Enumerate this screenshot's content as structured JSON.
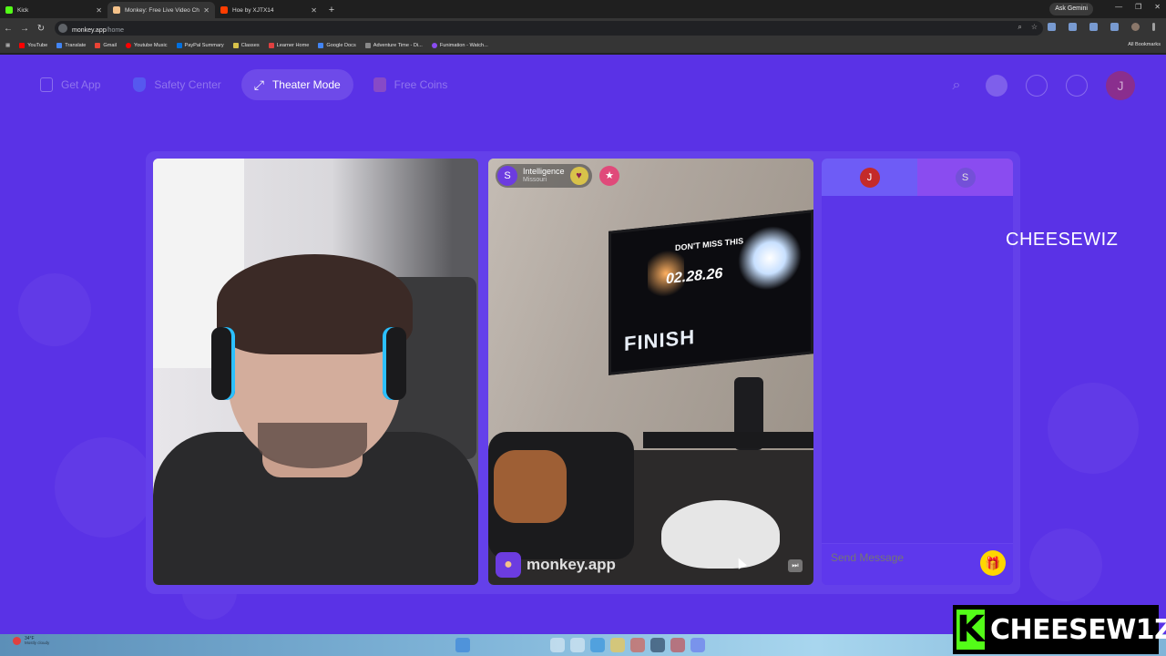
{
  "browser": {
    "tabs": [
      {
        "title": "Kick",
        "active": false,
        "favicon_color": "#53fc18"
      },
      {
        "title": "Monkey: Free Live Video Ch",
        "active": true,
        "favicon_color": "#f5c28a"
      },
      {
        "title": "Hoe by XJTX14",
        "active": false,
        "favicon_color": "#ff3d00"
      }
    ],
    "new_tab": "+",
    "gemini_label": "Ask Gemini",
    "url_host": "monkey.app",
    "url_path": "/home",
    "bookmarks": [
      {
        "label": "YouTube",
        "color": "#ff0000"
      },
      {
        "label": "Translate",
        "color": "#4285f4"
      },
      {
        "label": "Gmail",
        "color": "#ea4335"
      },
      {
        "label": "Youtube Music",
        "color": "#ff0000"
      },
      {
        "label": "PayPal Summary",
        "color": "#0070e0"
      },
      {
        "label": "Classes",
        "color": "#d8c24a"
      },
      {
        "label": "Learner Home",
        "color": "#e04040"
      },
      {
        "label": "Google Docs",
        "color": "#4285f4"
      },
      {
        "label": "Adventure Time - Di...",
        "color": "#888888"
      },
      {
        "label": "Funimation - Watch...",
        "color": "#8a4cf0"
      }
    ],
    "all_bookmarks": "All Bookmarks"
  },
  "app": {
    "nav": {
      "get_app": "Get App",
      "safety_center": "Safety Center",
      "theater_mode": "Theater Mode",
      "free_coins": "Free Coins"
    },
    "user_initial": "J",
    "peer": {
      "initial": "S",
      "name": "Intelligence",
      "location": "Missouri"
    },
    "watermark": "monkey.app",
    "chat": {
      "tab_self_initial": "J",
      "tab_peer_initial": "S",
      "input_placeholder": "Send Message"
    },
    "tv_text_top": "DON'T MISS THIS",
    "tv_text_date": "02.28.26",
    "tv_text_finish": "FINISH"
  },
  "stream_overlay": {
    "name_text": "CHEESEWIZ",
    "brand_text": "CHEESEW1Z",
    "brand_k": "K"
  },
  "taskbar": {
    "weather_temp": "34°F",
    "weather_cond": "Mostly cloudy"
  },
  "colors": {
    "page_bg": "#5a32e6",
    "accent": "#6c3ce0",
    "kick_green": "#53fc18"
  }
}
